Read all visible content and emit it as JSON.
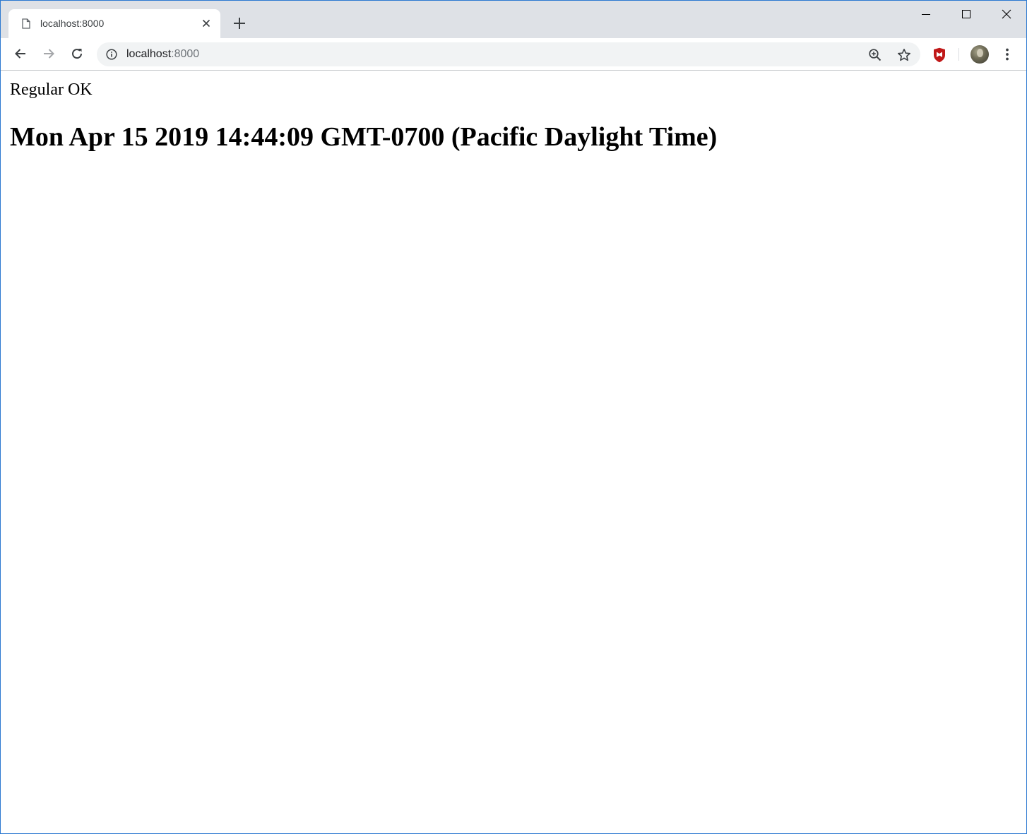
{
  "browser": {
    "tab": {
      "title": "localhost:8000",
      "favicon": "page-icon"
    },
    "new_tab_icon": "plus-icon",
    "window_controls": [
      "minimize-icon",
      "maximize-icon",
      "close-icon"
    ],
    "toolbar": {
      "back_icon": "arrow-left-icon",
      "forward_icon": "arrow-right-icon",
      "reload_icon": "reload-icon",
      "address": {
        "host": "localhost",
        "port": ":8000",
        "security_icon": "info-icon"
      },
      "zoom_icon": "zoom-in-icon",
      "bookmark_icon": "star-icon",
      "extension_icon": "mcafee-shield-icon",
      "menu_icon": "kebab-menu-icon",
      "accent_color": "#c01818"
    }
  },
  "page": {
    "status_text": "Regular OK",
    "date_text": "Mon Apr 15 2019 14:44:09 GMT-0700 (Pacific Daylight Time)"
  }
}
